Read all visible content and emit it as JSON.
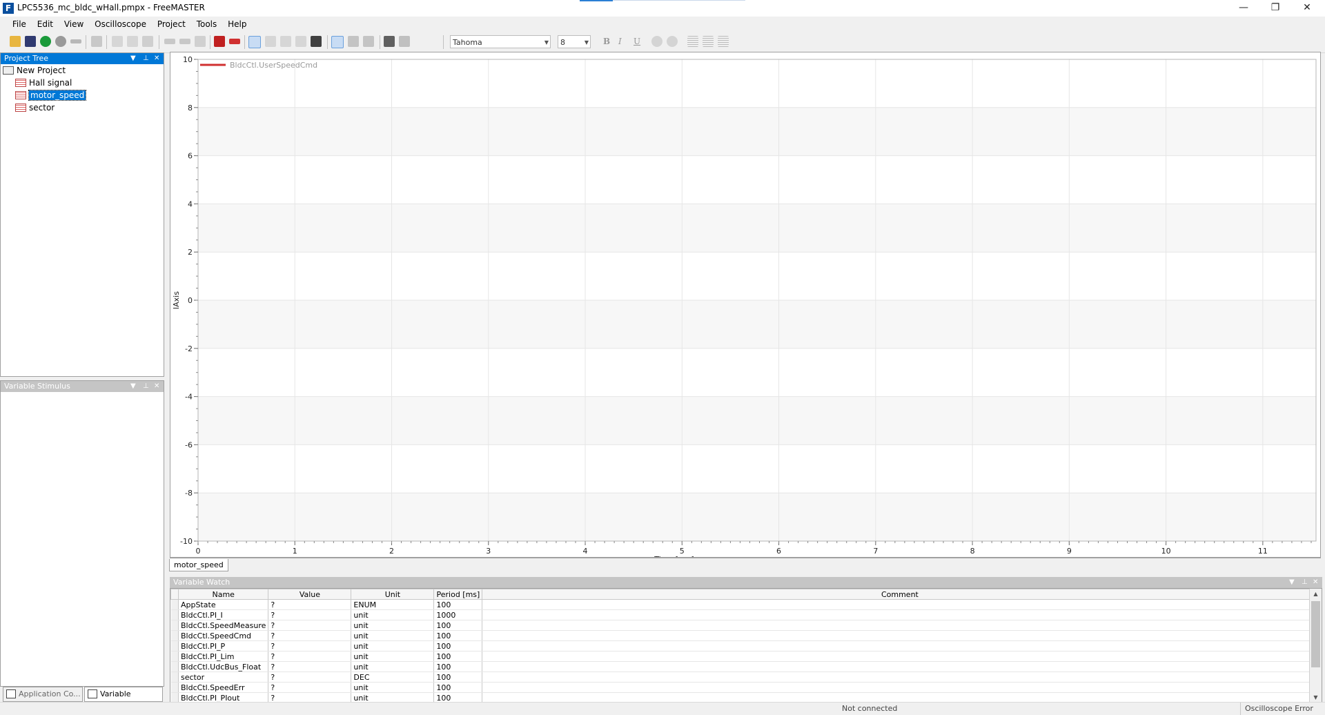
{
  "window": {
    "title": "LPC5536_mc_bldc_wHall.pmpx - FreeMASTER",
    "app_icon_letter": "F",
    "minimize": "—",
    "restore": "❐",
    "close": "✕"
  },
  "menu": [
    "File",
    "Edit",
    "View",
    "Oscilloscope",
    "Project",
    "Tools",
    "Help"
  ],
  "toolbar": {
    "font_name": "Tahoma",
    "font_size": "8",
    "bold": "B",
    "italic": "I",
    "underline": "U"
  },
  "project_tree": {
    "header": "Project Tree",
    "root": "New Project",
    "items": [
      "Hall signal",
      "motor_speed",
      "sector"
    ],
    "selected": "motor_speed"
  },
  "variable_stimulus": {
    "header": "Variable Stimulus"
  },
  "chart_data": {
    "type": "line",
    "legend": [
      "BldcCtl.UserSpeedCmd"
    ],
    "series": [
      {
        "name": "BldcCtl.UserSpeedCmd",
        "color": "#d03030",
        "x": [],
        "y": []
      }
    ],
    "xlabel": "Time [sec]",
    "ylabel": "lAxis",
    "xlim": [
      0,
      11.55
    ],
    "ylim": [
      -10,
      10
    ],
    "xticks": [
      0,
      1,
      2,
      3,
      4,
      5,
      6,
      7,
      8,
      9,
      10,
      11
    ],
    "yticks": [
      10,
      8,
      6,
      4,
      2,
      0,
      -2,
      -4,
      -6,
      -8,
      -10
    ],
    "legend_position": "top-left",
    "grid": true
  },
  "scope_tab": "motor_speed",
  "variable_watch": {
    "header": "Variable Watch",
    "columns": [
      "Name",
      "Value",
      "Unit",
      "Period [ms]",
      "Comment"
    ],
    "rows": [
      [
        "AppState",
        "?",
        "ENUM",
        "100",
        ""
      ],
      [
        "BldcCtl.PI_I",
        "?",
        "unit",
        "1000",
        ""
      ],
      [
        "BldcCtl.SpeedMeasure",
        "?",
        "unit",
        "100",
        ""
      ],
      [
        "BldcCtl.SpeedCmd",
        "?",
        "unit",
        "100",
        ""
      ],
      [
        "BldcCtl.PI_P",
        "?",
        "unit",
        "100",
        ""
      ],
      [
        "BldcCtl.PI_Lim",
        "?",
        "unit",
        "100",
        ""
      ],
      [
        "BldcCtl.UdcBus_Float",
        "?",
        "unit",
        "100",
        ""
      ],
      [
        "sector",
        "?",
        "DEC",
        "100",
        ""
      ],
      [
        "BldcCtl.SpeedErr",
        "?",
        "unit",
        "100",
        ""
      ],
      [
        "BldcCtl.PI_PIout",
        "?",
        "unit",
        "100",
        ""
      ]
    ]
  },
  "bottom_tabs": [
    "Application Co...",
    "Variable Stimulus"
  ],
  "status": {
    "connection": "Not connected",
    "message": "Oscilloscope Error"
  }
}
